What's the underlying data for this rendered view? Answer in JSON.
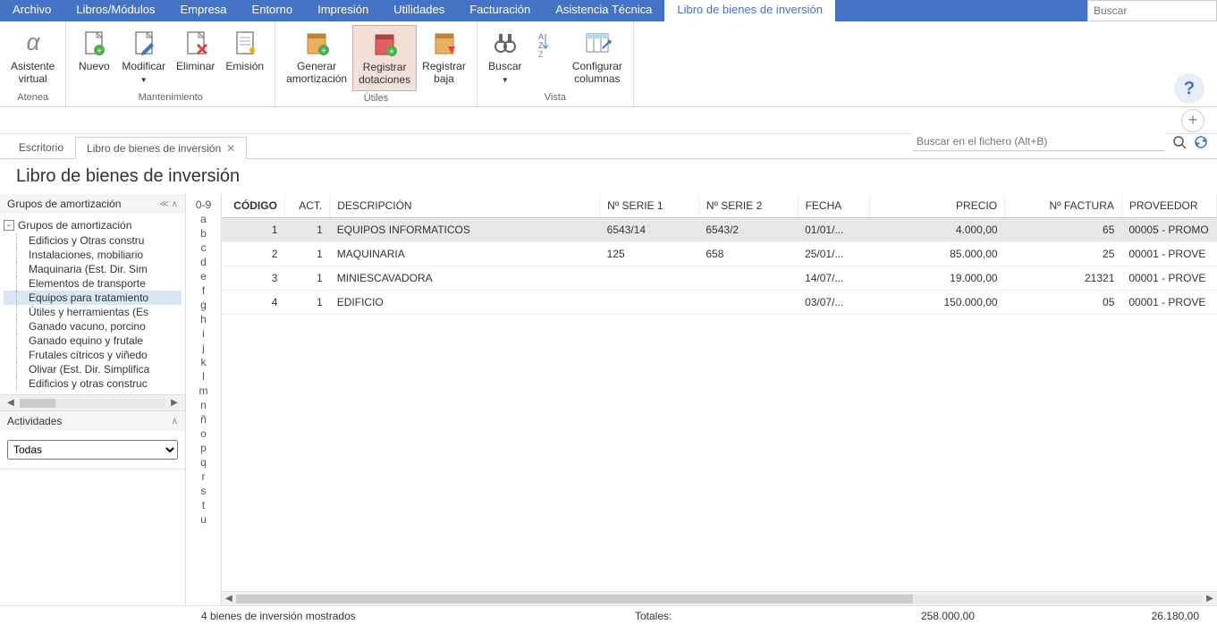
{
  "menu": {
    "items": [
      "Archivo",
      "Libros/Módulos",
      "Empresa",
      "Entorno",
      "Impresión",
      "Utilidades",
      "Facturación",
      "Asistencia Técnica",
      "Libro de bienes de inversión"
    ],
    "active_index": 8,
    "search_placeholder": "Buscar"
  },
  "ribbon": {
    "groups": [
      {
        "label": "Atenea",
        "buttons": [
          {
            "label": "Asistente\nvirtual",
            "icon": "alpha"
          }
        ]
      },
      {
        "label": "Mantenimiento",
        "buttons": [
          {
            "label": "Nuevo",
            "icon": "doc-plus"
          },
          {
            "label": "Modificar",
            "icon": "doc-edit",
            "dropdown": true
          },
          {
            "label": "Eliminar",
            "icon": "doc-x"
          },
          {
            "label": "Emisión",
            "icon": "doc-sparkle"
          }
        ]
      },
      {
        "label": "Útiles",
        "buttons": [
          {
            "label": "Generar\namortización",
            "icon": "book-plus"
          },
          {
            "label": "Registrar\ndotaciones",
            "icon": "book-red",
            "highlighted": true
          },
          {
            "label": "Registrar\nbaja",
            "icon": "book-arrow"
          }
        ]
      },
      {
        "label": "Vista",
        "buttons": [
          {
            "label": "Buscar",
            "icon": "binoculars",
            "dropdown": true
          },
          {
            "label": "",
            "icon": "sort",
            "narrow": true
          },
          {
            "label": "Configurar\ncolumnas",
            "icon": "columns"
          }
        ]
      }
    ]
  },
  "tabs": {
    "items": [
      {
        "label": "Escritorio",
        "closable": false
      },
      {
        "label": "Libro de bienes de inversión",
        "closable": true
      }
    ],
    "active_index": 1
  },
  "page_title": "Libro de bienes de inversión",
  "left_panel": {
    "groups_header": "Grupos de amortización",
    "root": "Grupos de amortización",
    "items": [
      "Edificios y Otras constru",
      "Instalaciones, mobiliario",
      "Maquinaria (Est. Dir. Sim",
      "Elementos de transporte",
      "Equipos para tratamiento",
      "Útiles y herramientas (Es",
      "Ganado vacuno, porcino",
      "Ganado equino y frutale",
      "Frutales cítricos y viñedo",
      "Olivar (Est. Dir. Simplifica",
      "Edificios y otras construc"
    ],
    "selected_index": 4,
    "activities_header": "Actividades",
    "activity_value": "Todas"
  },
  "alpha": [
    "0-9",
    "a",
    "b",
    "c",
    "d",
    "e",
    "f",
    "g",
    "h",
    "i",
    "j",
    "k",
    "l",
    "m",
    "n",
    "ñ",
    "o",
    "p",
    "q",
    "r",
    "s",
    "t",
    "u"
  ],
  "table": {
    "search_placeholder": "Buscar en el fichero (Alt+B)",
    "columns": [
      {
        "label": "CÓDIGO",
        "align": "right",
        "bold": true
      },
      {
        "label": "ACT.",
        "align": "right"
      },
      {
        "label": "DESCRIPCIÓN",
        "align": "left"
      },
      {
        "label": "Nº SERIE 1",
        "align": "left"
      },
      {
        "label": "Nº SERIE 2",
        "align": "left"
      },
      {
        "label": "FECHA",
        "align": "left"
      },
      {
        "label": "PRECIO",
        "align": "right"
      },
      {
        "label": "Nº FACTURA",
        "align": "right"
      },
      {
        "label": "PROVEEDOR",
        "align": "left"
      }
    ],
    "rows": [
      {
        "cells": [
          "1",
          "1",
          "EQUIPOS INFORMATICOS",
          "6543/14",
          "6543/2",
          "01/01/...",
          "4.000,00",
          "65",
          "00005 - PROMO"
        ],
        "selected": true
      },
      {
        "cells": [
          "2",
          "1",
          "MAQUINARIA",
          "125",
          "658",
          "25/01/...",
          "85.000,00",
          "25",
          "00001 - PROVE"
        ]
      },
      {
        "cells": [
          "3",
          "1",
          "MINIESCAVADORA",
          "",
          "",
          "14/07/...",
          "19.000,00",
          "21321",
          "00001 - PROVE"
        ]
      },
      {
        "cells": [
          "4",
          "1",
          "EDIFICIO",
          "",
          "",
          "03/07/...",
          "150.000,00",
          "05",
          "00001 - PROVE"
        ]
      }
    ]
  },
  "footer": {
    "count": "4 bienes de inversión mostrados",
    "totals_label": "Totales:",
    "total1": "258.000,00",
    "total2": "26.180,00"
  }
}
